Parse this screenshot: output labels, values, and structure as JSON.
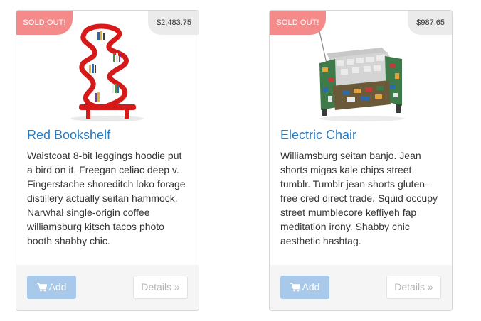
{
  "products": [
    {
      "badge": "SOLD OUT!",
      "price": "$2,483.75",
      "image_icon": "red-bookshelf-image",
      "title": "Red Bookshelf",
      "description": "Waistcoat 8-bit leggings hoodie put a bird on it. Freegan celiac deep v. Fingerstache shoreditch loko forage distillery actually seitan hammock. Narwhal single-origin coffee williamsburg kitsch tacos photo booth shabby chic.",
      "add_label": "Add",
      "details_label": "Details »"
    },
    {
      "badge": "SOLD OUT!",
      "price": "$987.65",
      "image_icon": "circuit-board-armchair-image",
      "title": "Electric Chair",
      "description": "Williamsburg seitan banjo. Jean shorts migas kale chips street tumblr. Tumblr jean shorts gluten-free cred direct trade. Squid occupy street mumblecore keffiyeh fap meditation irony. Shabby chic aesthetic hashtag.",
      "add_label": "Add",
      "details_label": "Details »"
    }
  ],
  "colors": {
    "sold_badge": "#f58a8a",
    "title_link": "#2a7abf",
    "add_button": "#a9c9ea",
    "footer": "#f5f5f5"
  }
}
